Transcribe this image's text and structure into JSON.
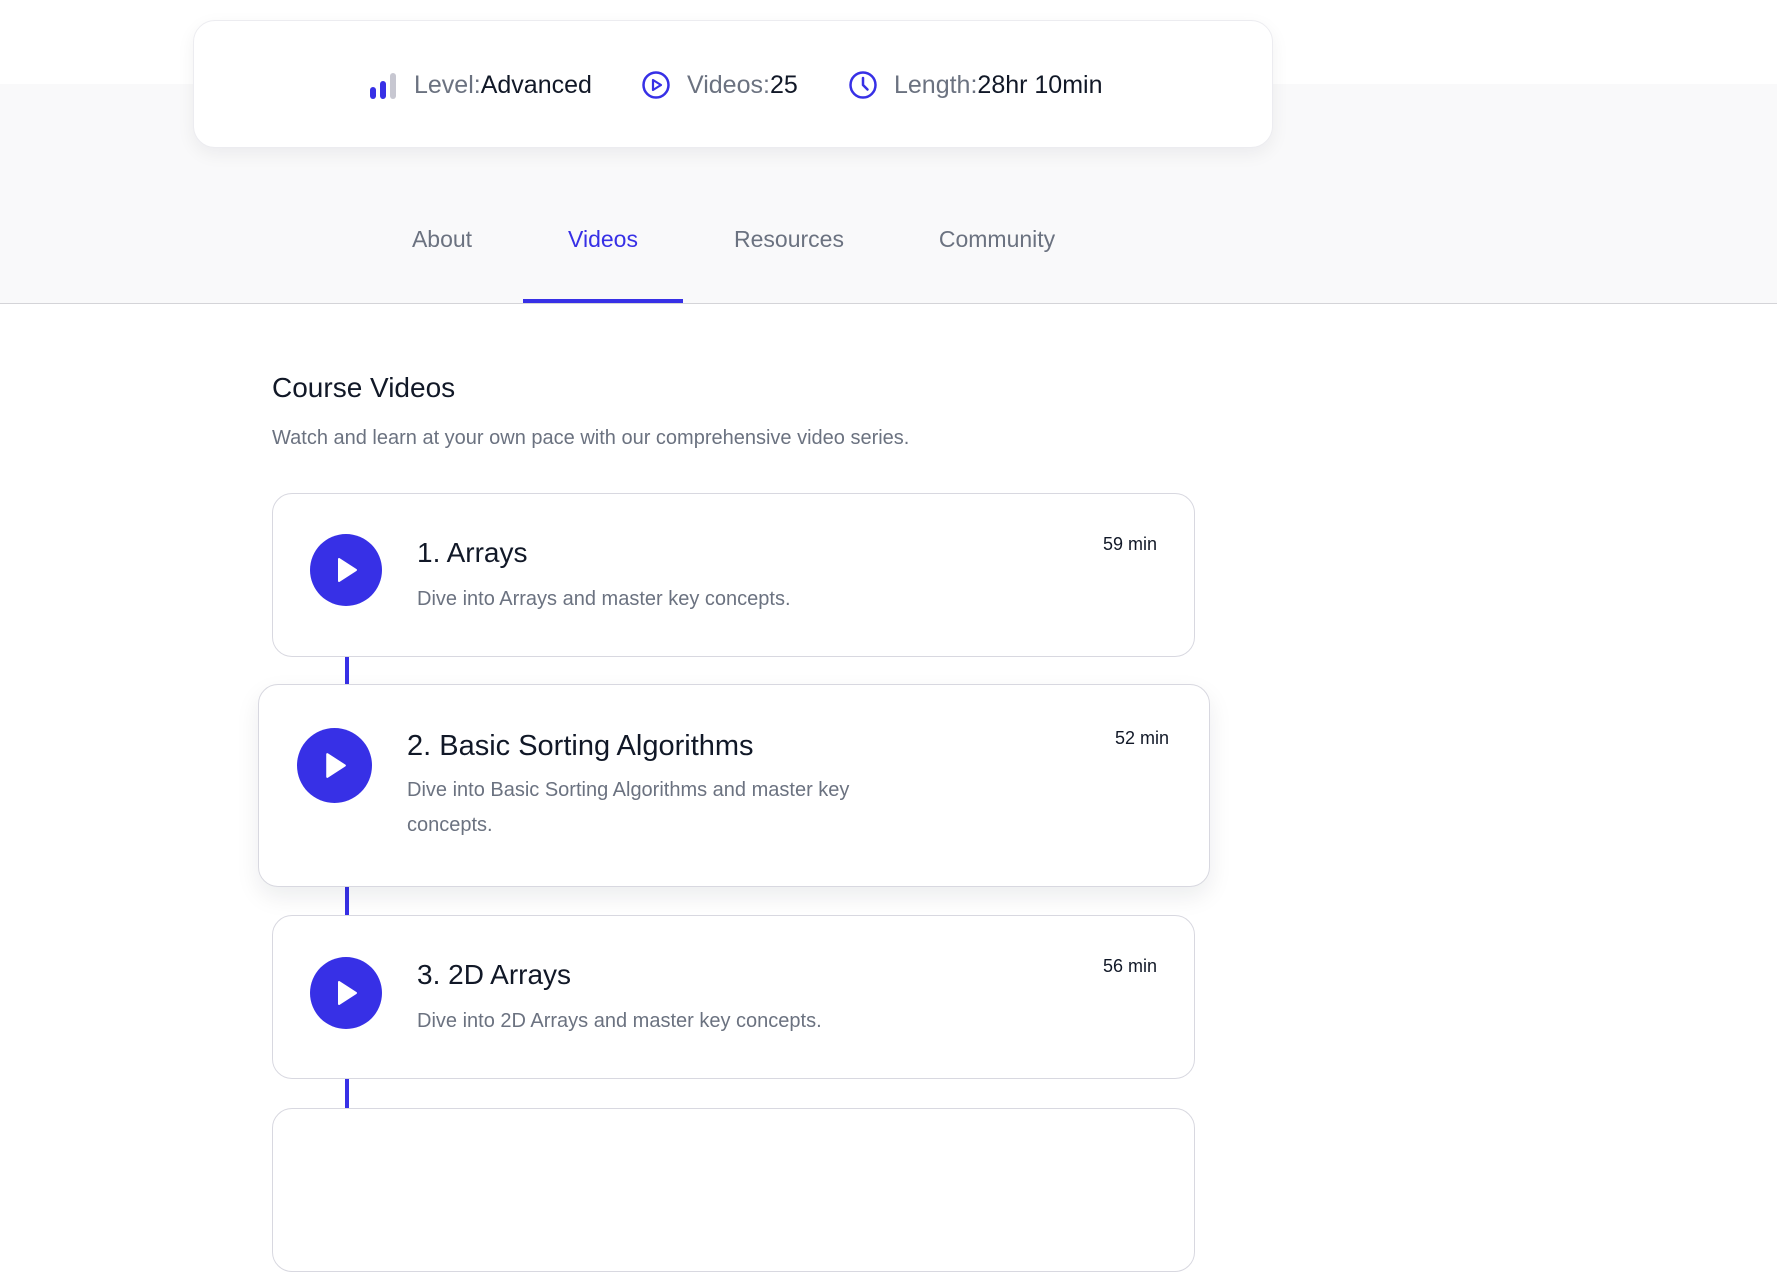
{
  "course_stats": {
    "level": {
      "label": "Level:",
      "value": "Advanced",
      "icon": "level-bars-icon"
    },
    "videos": {
      "label": "Videos:",
      "value": "25",
      "icon": "play-circle-icon"
    },
    "length": {
      "label": "Length:",
      "value": "28hr 10min",
      "icon": "clock-icon"
    }
  },
  "tabs": [
    {
      "label": "About",
      "active": false
    },
    {
      "label": "Videos",
      "active": true
    },
    {
      "label": "Resources",
      "active": false
    },
    {
      "label": "Community",
      "active": false
    }
  ],
  "section": {
    "title": "Course Videos",
    "subtitle": "Watch and learn at your own pace with our comprehensive video series."
  },
  "videos": [
    {
      "title": "1. Arrays",
      "description": "Dive into Arrays and master key concepts.",
      "duration": "59 min"
    },
    {
      "title": "2. Basic Sorting Algorithms",
      "description": "Dive into Basic Sorting Algorithms and master key concepts.",
      "duration": "52 min"
    },
    {
      "title": "3. 2D Arrays",
      "description": "Dive into 2D Arrays and master key concepts.",
      "duration": "56 min"
    }
  ],
  "colors": {
    "accent": "#3730e6",
    "text_primary": "#111827",
    "text_muted": "#6b7280",
    "band_gray": "#f9f9fa",
    "border": "#d8d8e0"
  }
}
